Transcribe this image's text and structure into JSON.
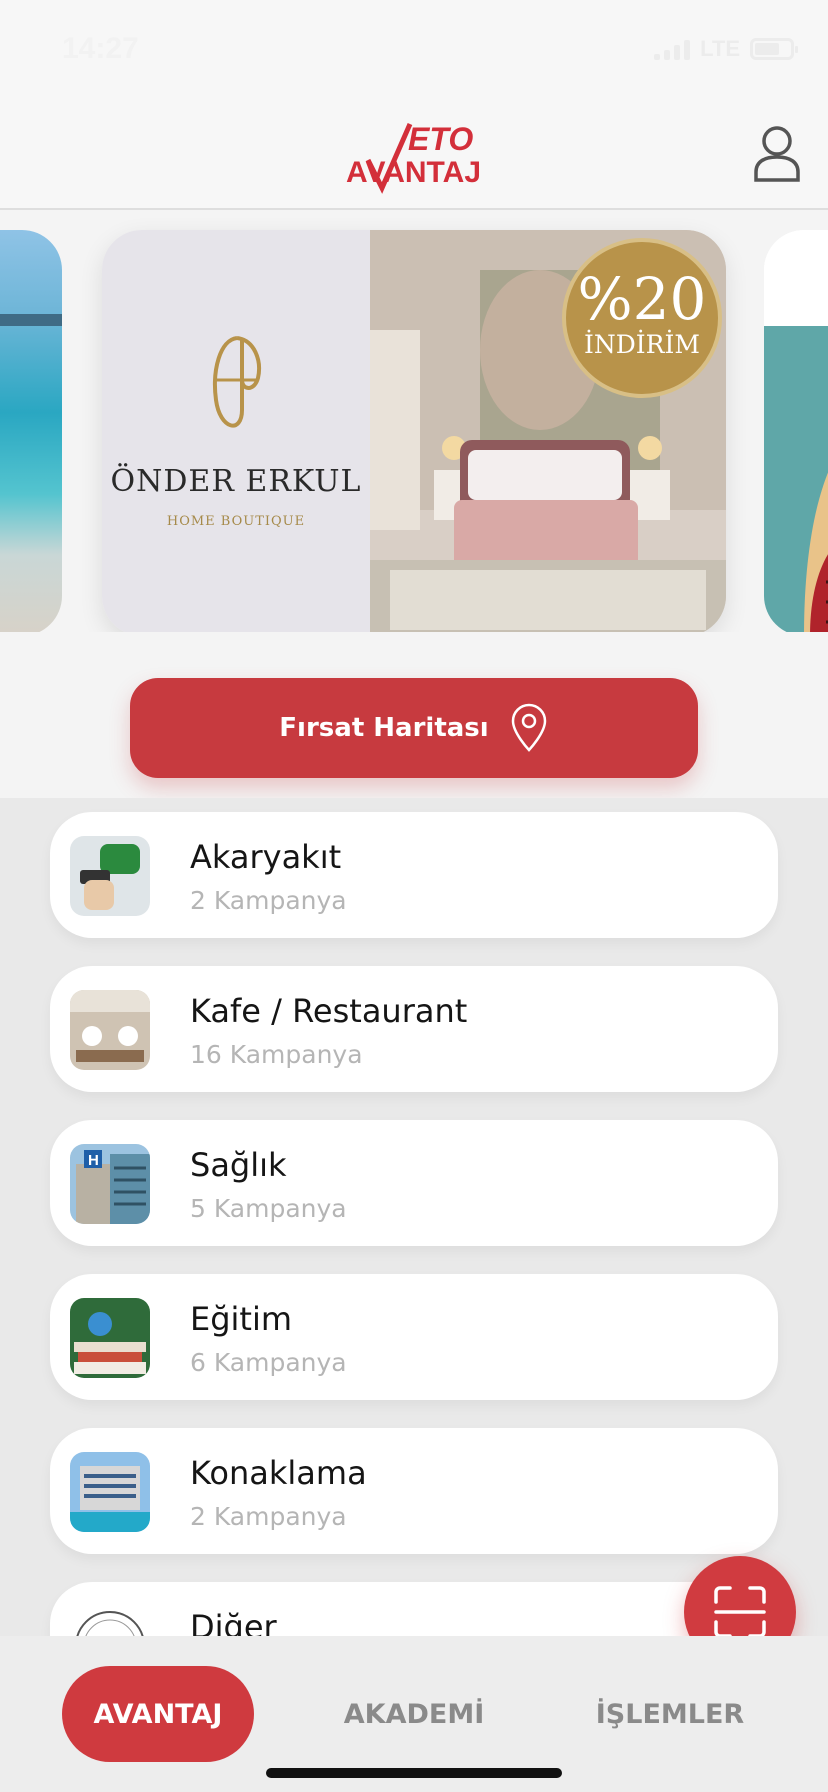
{
  "status_bar": {
    "time": "14:27",
    "network": "LTE"
  },
  "header": {
    "logo_top": "ETO",
    "logo_bottom": "AVANTAJ"
  },
  "carousel": {
    "main_slide": {
      "brand_name": "ÖNDER ERKUL",
      "brand_sub": "HOME BOUTIQUE",
      "discount_pct": "%20",
      "discount_label": "İNDİRİM"
    }
  },
  "map_button": {
    "label": "Fırsat Haritası"
  },
  "categories": [
    {
      "title": "Akaryakıt",
      "subtitle": "2 Kampanya"
    },
    {
      "title": "Kafe / Restaurant",
      "subtitle": "16 Kampanya"
    },
    {
      "title": "Sağlık",
      "subtitle": "5 Kampanya"
    },
    {
      "title": "Eğitim",
      "subtitle": "6 Kampanya"
    },
    {
      "title": "Konaklama",
      "subtitle": "2 Kampanya"
    },
    {
      "title": "Diğer",
      "subtitle": ""
    }
  ],
  "bottom_nav": {
    "avantaj": "AVANTAJ",
    "akademi": "AKADEMİ",
    "islemler": "İŞLEMLER"
  },
  "colors": {
    "brand_red": "#c73a3f",
    "muted_text": "#b5b5b5",
    "gold": "#b8934a"
  }
}
